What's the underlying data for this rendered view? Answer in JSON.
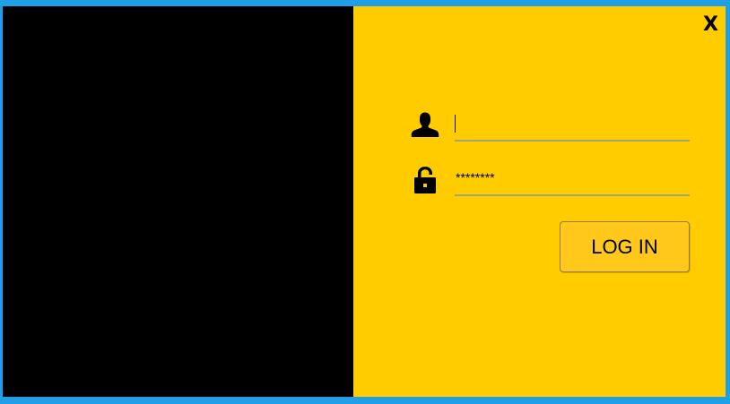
{
  "window": {
    "close_label": "X"
  },
  "form": {
    "username": {
      "icon": "user-icon",
      "value": ""
    },
    "password": {
      "icon": "unlock-icon",
      "masked_value": "********"
    },
    "login_label": "LOG IN"
  },
  "colors": {
    "frame": "#1e9fe8",
    "left_panel": "#000000",
    "right_panel": "#ffcc00",
    "button": "#ffc81a"
  }
}
